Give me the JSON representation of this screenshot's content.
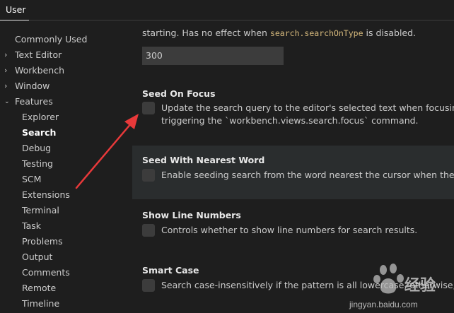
{
  "header": {
    "tab_user": "User"
  },
  "sidebar": {
    "items": [
      {
        "label": "Commonly Used",
        "expandable": false
      },
      {
        "label": "Text Editor",
        "expandable": true,
        "expanded": false
      },
      {
        "label": "Workbench",
        "expandable": true,
        "expanded": false
      },
      {
        "label": "Window",
        "expandable": true,
        "expanded": false
      },
      {
        "label": "Features",
        "expandable": true,
        "expanded": true
      }
    ],
    "features_children": [
      "Explorer",
      "Search",
      "Debug",
      "Testing",
      "SCM",
      "Extensions",
      "Terminal",
      "Task",
      "Problems",
      "Output",
      "Comments",
      "Remote",
      "Timeline"
    ],
    "active_item": "Search"
  },
  "main": {
    "prev_desc_text": "starting. Has no effect when ",
    "prev_desc_code": "search.searchOnType",
    "prev_desc_tail": " is disabled.",
    "debounce_value": "300",
    "settings": [
      {
        "title": "Seed On Focus",
        "desc_line1": "Update the search query to the editor's selected text when focusing the s",
        "desc_line2": "triggering the `workbench.views.search.focus` command.",
        "checked": false
      },
      {
        "title": "Seed With Nearest Word",
        "desc_line1": "Enable seeding search from the word nearest the cursor when the active",
        "checked": false
      },
      {
        "title": "Show Line Numbers",
        "desc_line1": "Controls whether to show line numbers for search results.",
        "checked": false
      },
      {
        "title": "Smart Case",
        "desc_line1": "Search case-insensitively if the pattern is all lowercase, otherwise, search",
        "checked": false
      }
    ]
  },
  "overlay": {
    "watermark_brand": "经验",
    "watermark_url": "jingyan.baidu.com",
    "arrow_color": "#e8393a"
  },
  "colors": {
    "background": "#1e1e1e",
    "input_bg": "#3c3c3c",
    "highlight_row": "#2a2d2e",
    "code_text": "#d7ba7d"
  }
}
